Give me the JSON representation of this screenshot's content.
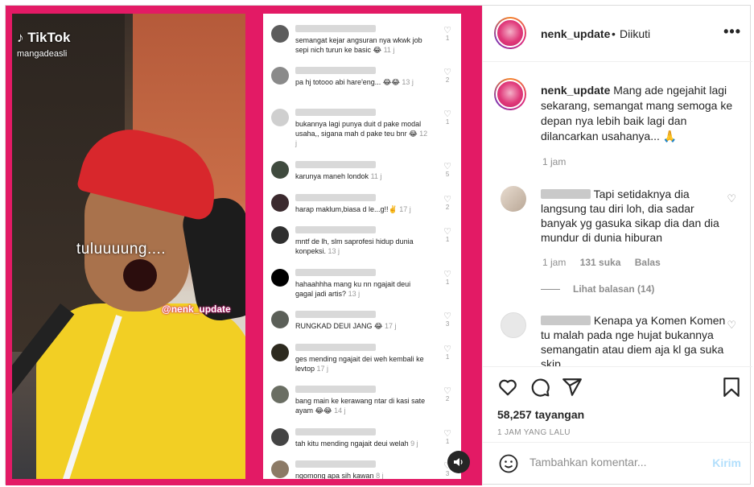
{
  "video": {
    "brand": "TikTok",
    "tiktok_user": "mangadeasli",
    "overlay_text": "tuluuuung....",
    "watermark": "@nenk_update"
  },
  "tiktok_comments": [
    {
      "text": "semangat kejar angsuran nya wkwk job sepi nich turun ke basic 😂",
      "time": "11 j",
      "likes": "1"
    },
    {
      "text": "pa hj totooo abi hare'eng... 😂😂",
      "time": "13 j",
      "likes": "2"
    },
    {
      "text": "bukannya lagi punya duit d pake modal usaha,, sigana mah d pake teu bnr 😂",
      "time": "12 j",
      "likes": "1"
    },
    {
      "text": "karunya maneh londok",
      "time": "11 j",
      "likes": "5"
    },
    {
      "text": "harap maklum,biasa d le...g!!✌️",
      "time": "17 j",
      "likes": "2"
    },
    {
      "text": "mntf de lh, slm saprofesi hidup dunia konpeksi.",
      "time": "13 j",
      "likes": "1"
    },
    {
      "text": "hahaahhha mang ku nn ngajait deui gagal jadi artis?",
      "time": "13 j",
      "likes": "1"
    },
    {
      "text": "RUNGKAD DEUI JANG 😂",
      "time": "17 j",
      "likes": "3"
    },
    {
      "text": "ges mending ngajait dei weh kembali ke levtop",
      "time": "17 j",
      "likes": "1"
    },
    {
      "text": "bang main ke kerawang ntar di kasi sate ayam 😂😂",
      "time": "14 j",
      "likes": "2"
    },
    {
      "text": "tah kitu mending ngajait deui welah",
      "time": "9 j",
      "likes": "1"
    },
    {
      "text": "ngomong apa sih kawan",
      "time": "8 j",
      "likes": "3"
    }
  ],
  "header": {
    "username": "nenk_update",
    "separator": "•",
    "follow_status": "Diikuti",
    "more": "•••"
  },
  "caption": {
    "username": "nenk_update",
    "text": " Mang ade ngejahit lagi sekarang, semangat mang semoga ke depan nya lebih baik lagi dan dilancarkan usahanya... 🙏",
    "time": "1 jam"
  },
  "comments": [
    {
      "text": "Tapi setidaknya dia langsung tau diri loh, dia sadar banyak yg gasuka sikap dia dan dia mundur di dunia hiburan",
      "time": "1 jam",
      "likes": "131 suka",
      "reply": "Balas",
      "view_replies": "Lihat balasan (14)"
    },
    {
      "text": "Kenapa ya Komen Komen tu malah pada nge hujat bukannya semangatin atau diem aja kl ga suka skip"
    }
  ],
  "actions": {
    "views": "58,257 tayangan",
    "date": "1 JAM YANG LALU"
  },
  "add_comment": {
    "placeholder": "Tambahkan komentar...",
    "post": "Kirim"
  },
  "colors": {
    "media_bg": "#e31a65",
    "link_disabled": "#b2dffc"
  }
}
